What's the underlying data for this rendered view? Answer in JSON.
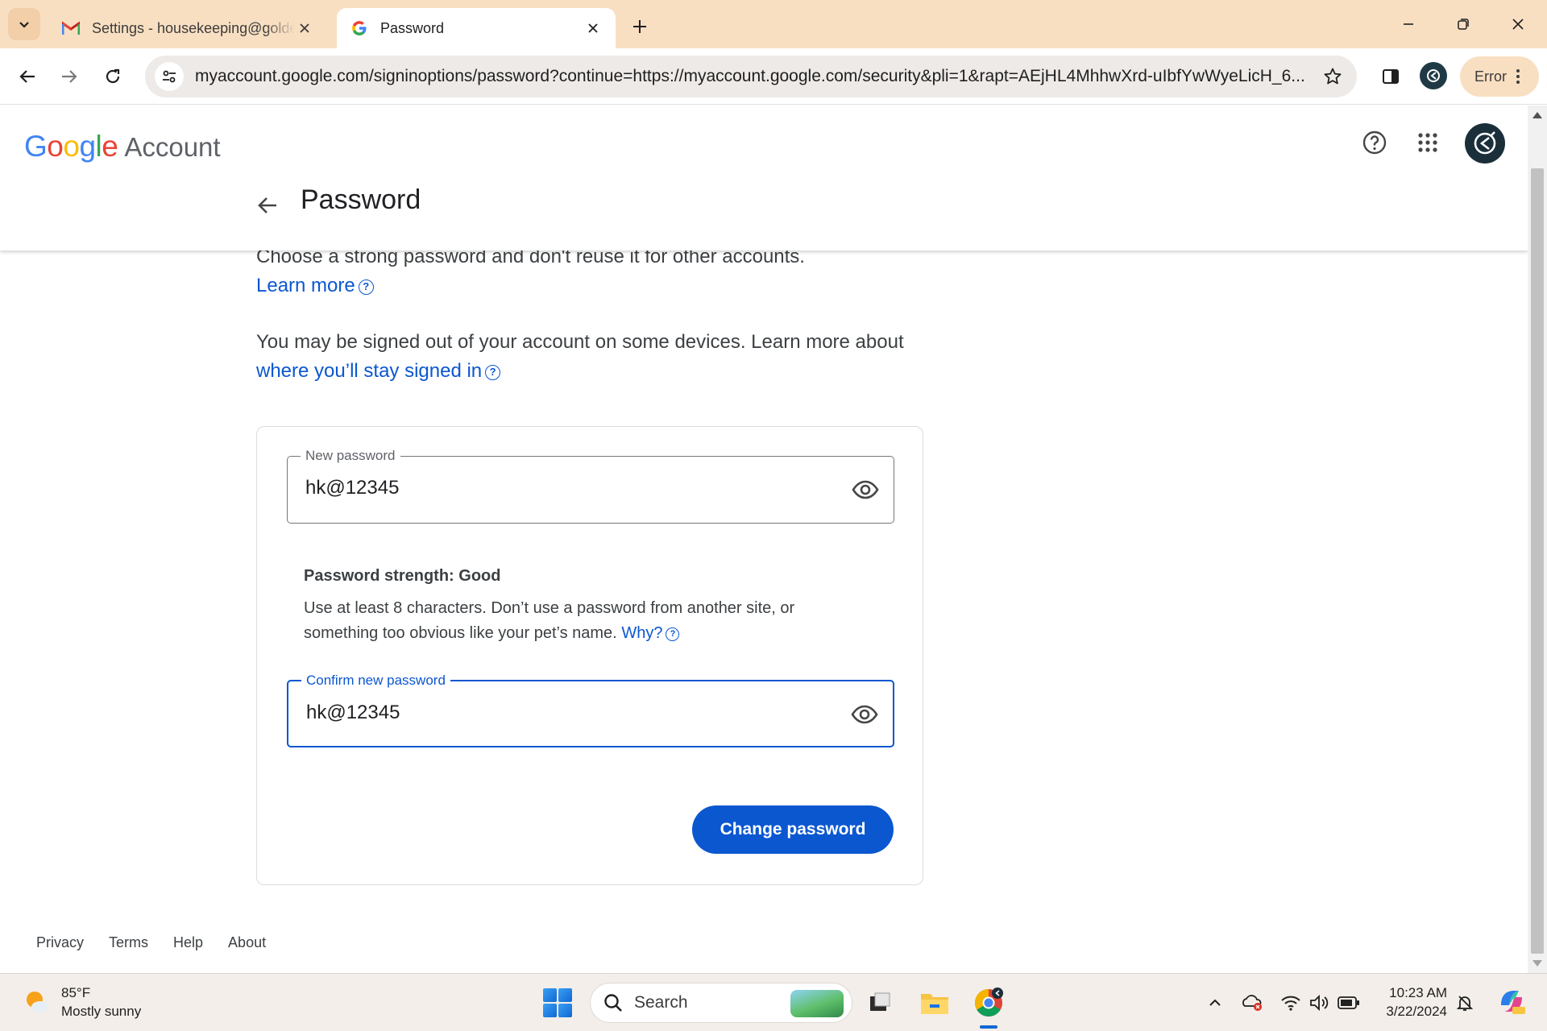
{
  "browser": {
    "tabs": [
      {
        "title": "Settings - housekeeping@goldenkey.com",
        "icon": "gmail-icon",
        "active": false
      },
      {
        "title": "Password",
        "icon": "google-icon",
        "active": true
      }
    ],
    "url": "myaccount.google.com/signinoptions/password?continue=https://myaccount.google.com/security&pli=1&rapt=AEjHL4MhhwXrd-uIbfYwWyeLicH_6...",
    "error_label": "Error"
  },
  "header": {
    "logo_google": "Google",
    "logo_account": "Account",
    "page_title": "Password"
  },
  "intro": {
    "line1": "Choose a strong password and don't reuse it for other accounts.",
    "learn_more": "Learn more",
    "signed_out_text": "You may be signed out of your account on some devices. Learn more about",
    "signed_in_link": "where you’ll stay signed in"
  },
  "form": {
    "new_password": {
      "label": "New password",
      "value": "hk@12345"
    },
    "strength": "Password strength: Good",
    "hint": "Use at least 8 characters. Don’t use a password from another site, or something too obvious like your pet’s name.",
    "why_link": "Why?",
    "confirm_password": {
      "label": "Confirm new password",
      "value": "hk@12345"
    },
    "submit_label": "Change password"
  },
  "footer": {
    "links": [
      "Privacy",
      "Terms",
      "Help",
      "About"
    ]
  },
  "taskbar": {
    "weather_temp": "85°F",
    "weather_desc": "Mostly sunny",
    "search_label": "Search",
    "time": "10:23 AM",
    "date": "3/22/2024"
  },
  "colors": {
    "accent": "#0b57d0",
    "tabstrip": "#f9dfc2"
  }
}
